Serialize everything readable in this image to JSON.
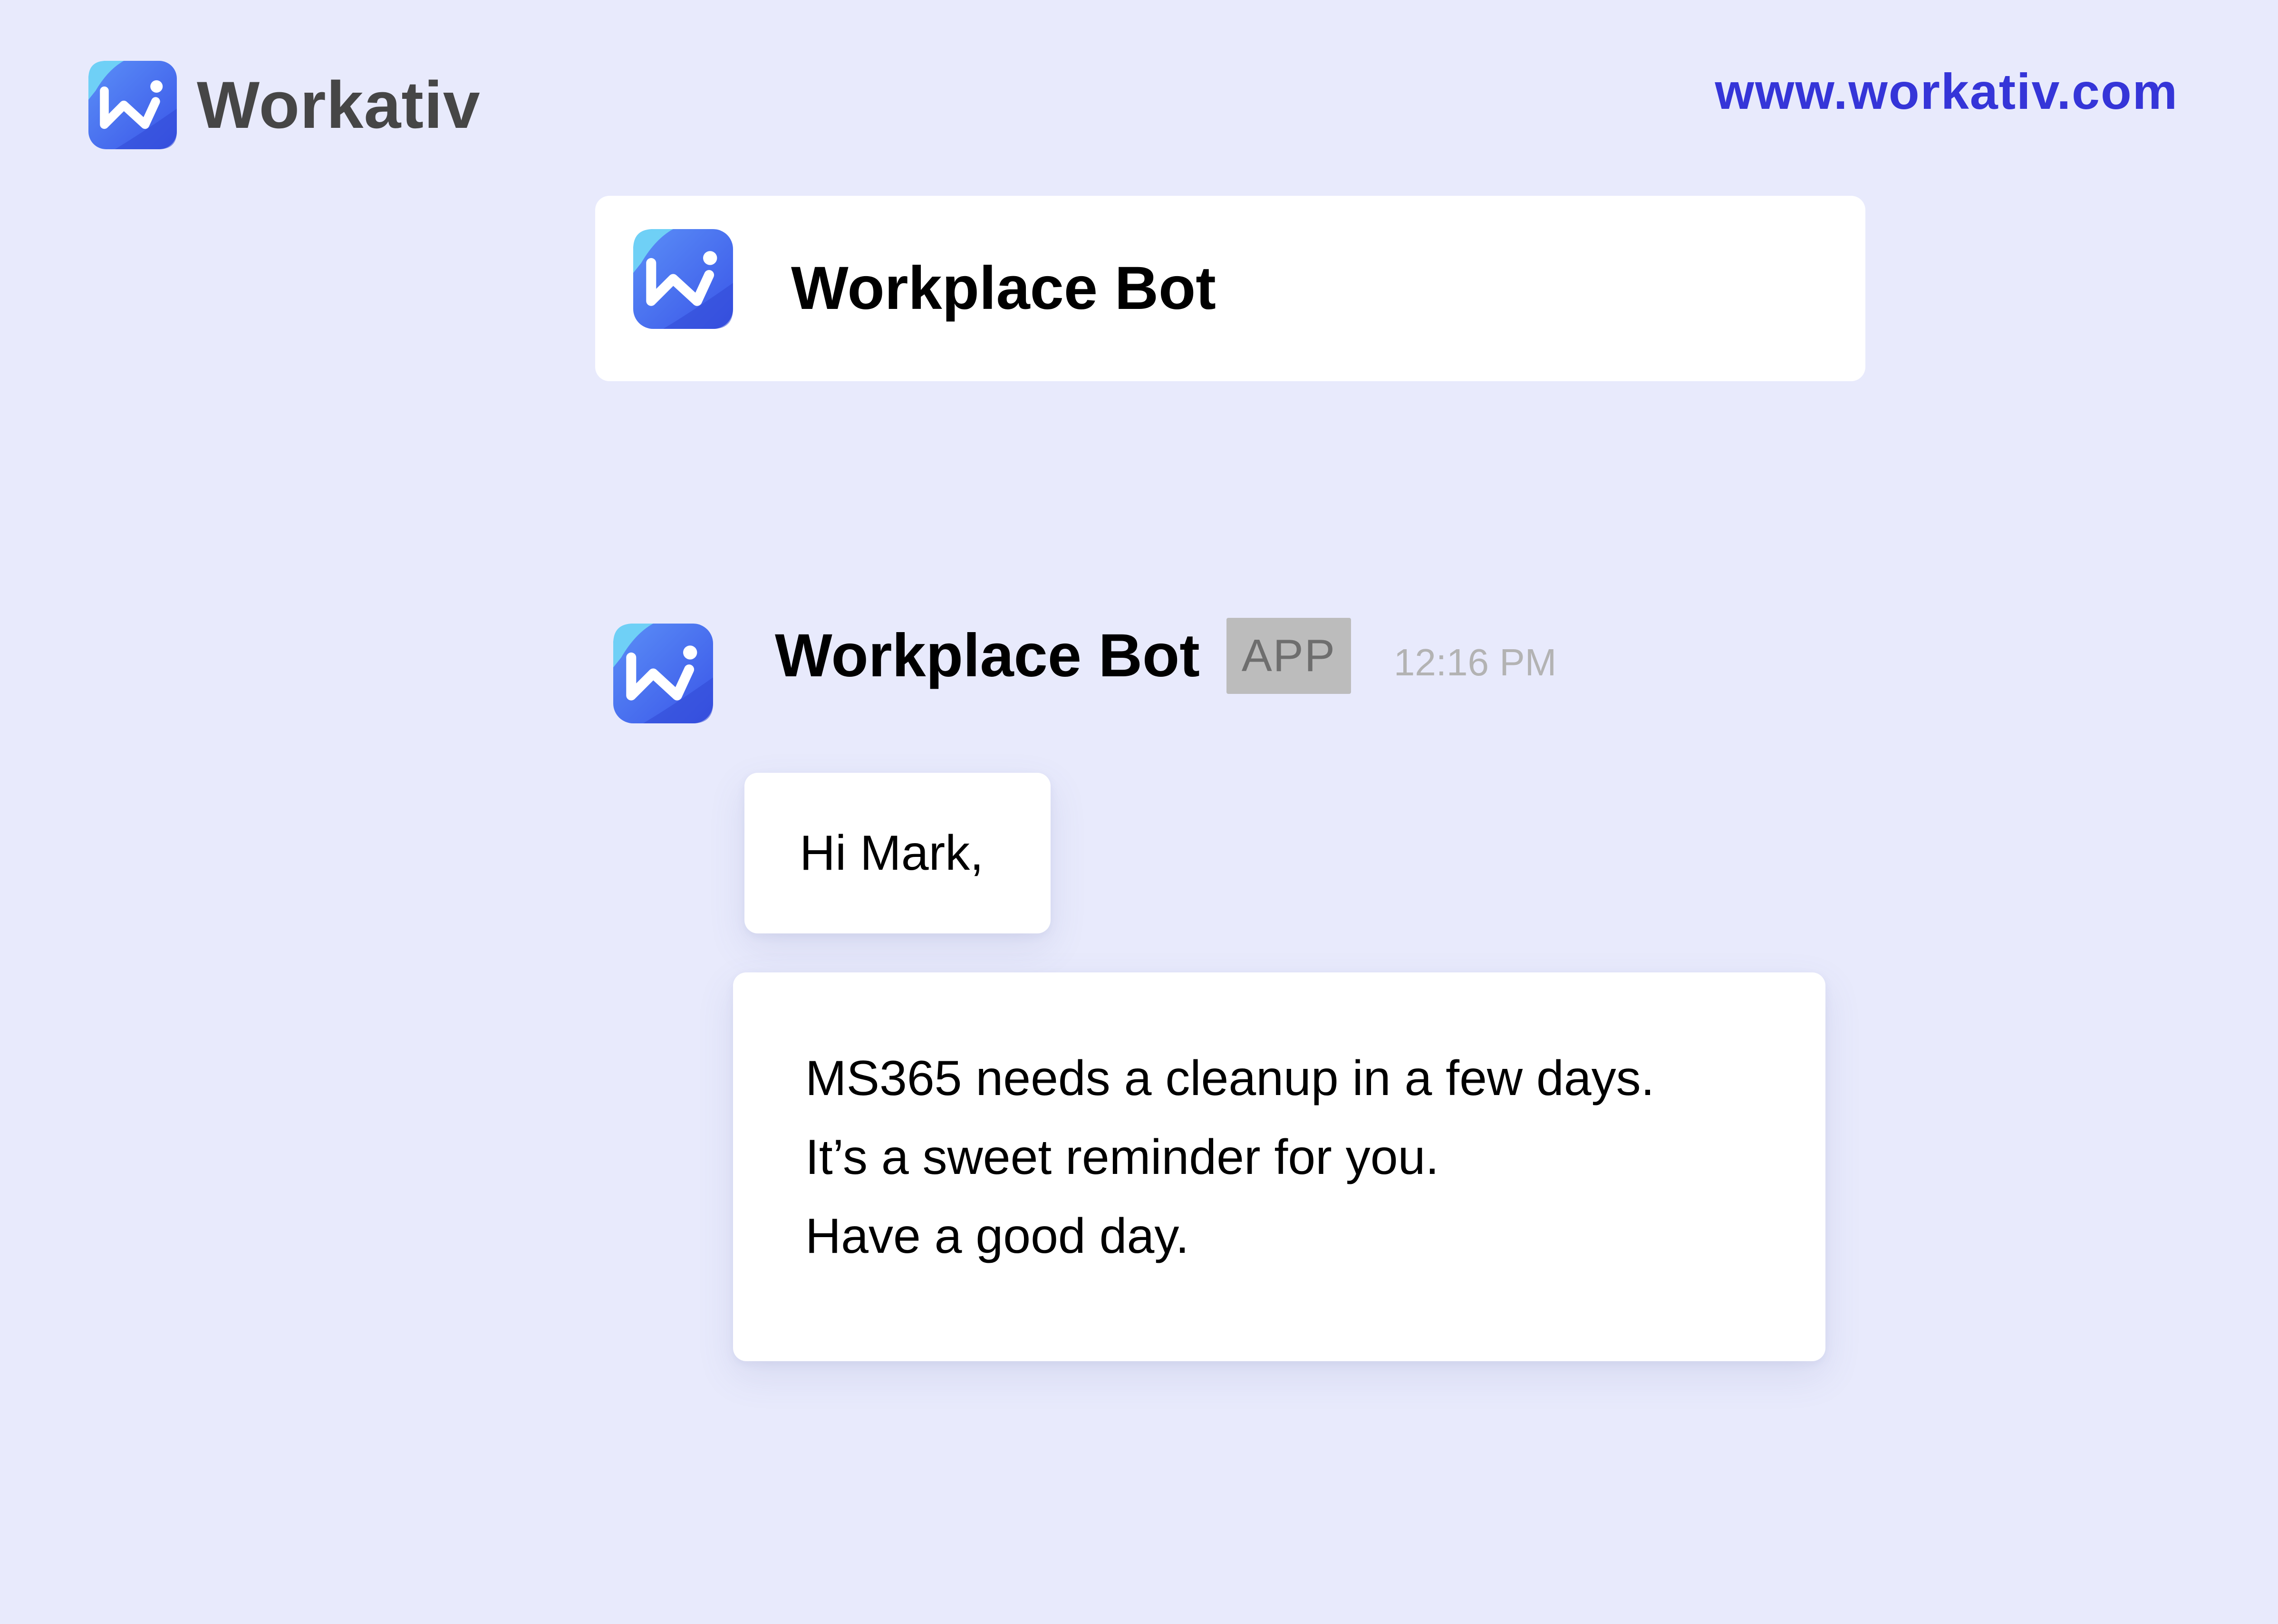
{
  "brand": {
    "name": "Workativ",
    "url": "www.workativ.com"
  },
  "header": {
    "title": "Workplace Bot"
  },
  "message": {
    "sender": "Workplace Bot",
    "badge": "APP",
    "time": "12:16 PM",
    "greeting": "Hi Mark,",
    "lines": [
      "MS365 needs a cleanup in a few days.",
      "It’s a sweet reminder for you.",
      "Have a good day."
    ]
  },
  "icons": {
    "logo": "workativ-logo-icon"
  },
  "colors": {
    "background": "#e8eafc",
    "link": "#3535d8",
    "brand_text": "#464646",
    "logo_blue": "#3f63ee",
    "logo_light": "#62c7f7",
    "badge_bg": "#bcbcbc",
    "timestamp": "#b3b3b3"
  }
}
